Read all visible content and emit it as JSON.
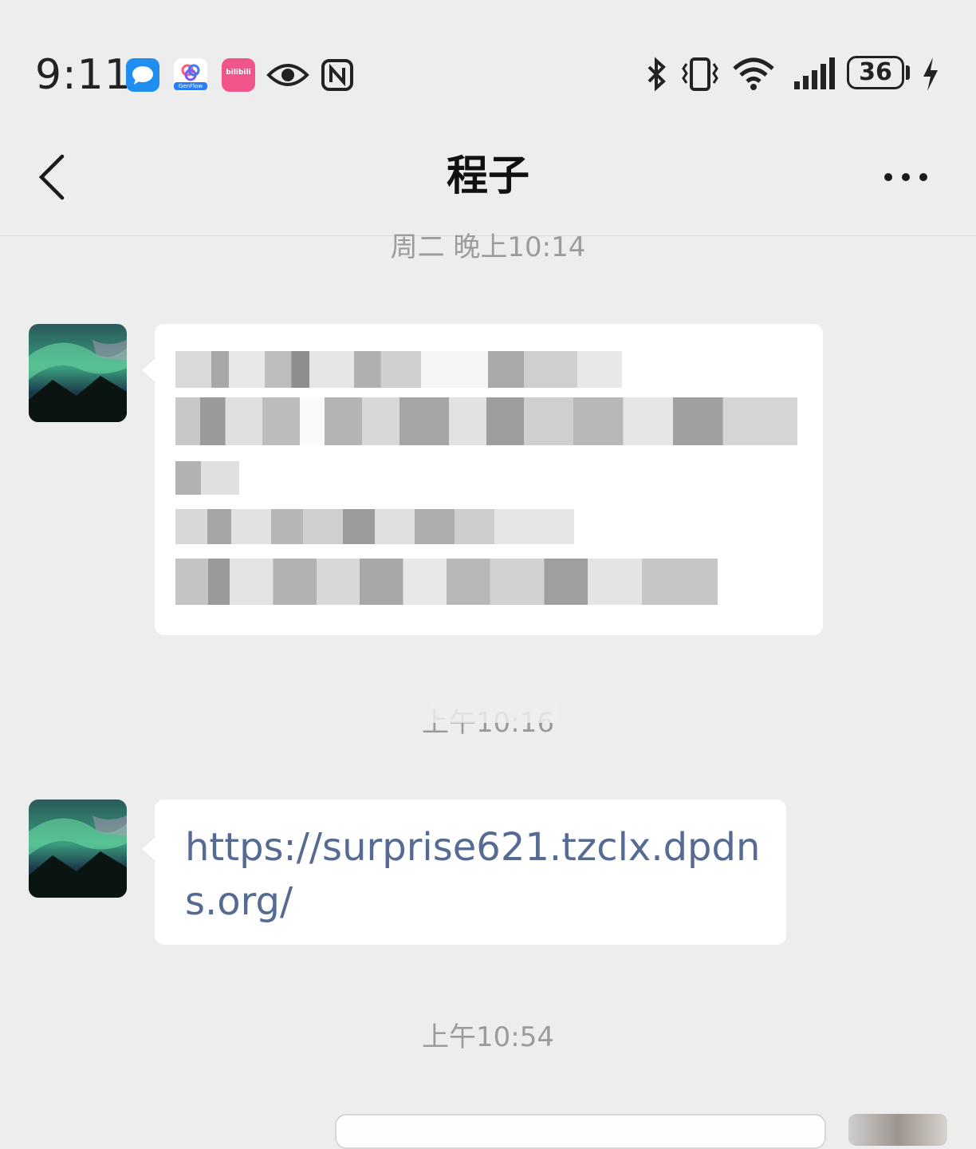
{
  "status_bar": {
    "time": "9:11",
    "notification_icons": [
      "message-app-icon",
      "genflow-app-icon",
      "bilibili-app-icon",
      "eye-icon",
      "nfc-icon"
    ],
    "genflow_label": "GenFlow",
    "bilibili_label": "bilibili",
    "system_icons": [
      "bluetooth-icon",
      "vibrate-icon",
      "wifi-icon",
      "cellular-signal-icon",
      "battery-icon",
      "charging-icon"
    ],
    "battery_level": "36"
  },
  "nav": {
    "title": "程子",
    "back_icon": "chevron-left-icon",
    "more_icon": "more-dots-icon"
  },
  "messages": {
    "ts1": "周二 晚上10:14",
    "ts2": "上午10:16",
    "ts3": "上午10:54",
    "link": "https://surprise621.tzclx.dpdns.org/"
  },
  "colors": {
    "background": "#ededed",
    "bubble": "#ffffff",
    "link": "#566b94",
    "timestamp": "#9b9b9b"
  }
}
